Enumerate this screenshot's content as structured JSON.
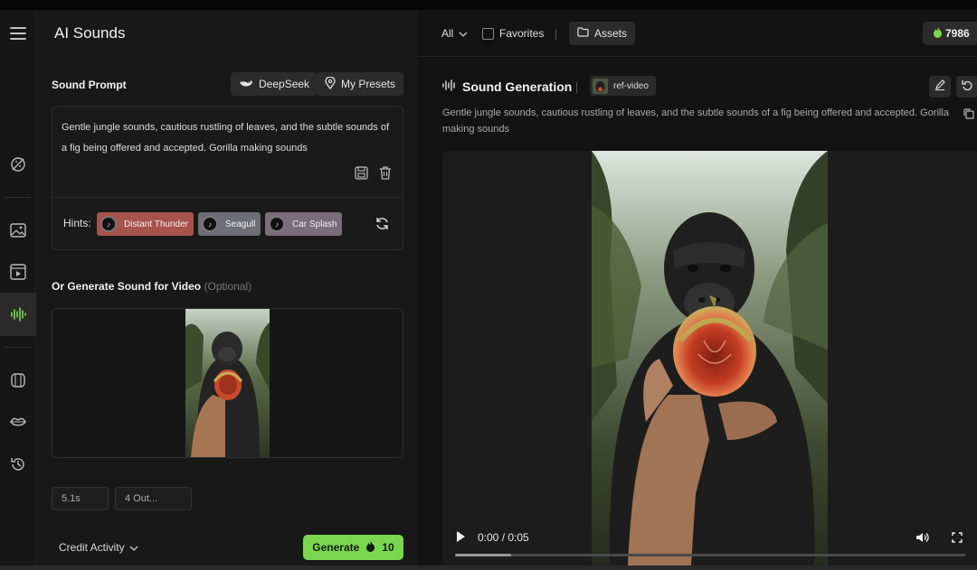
{
  "app": {
    "title": "AI Sounds"
  },
  "sound_prompt": {
    "title": "Sound Prompt",
    "deepseek_label": "DeepSeek",
    "presets_label": "My Presets",
    "text": "Gentle jungle sounds, cautious rustling of leaves, and the subtle sounds of a fig being offered and accepted. Gorilla making sounds",
    "hints_label": "Hints:",
    "hints": [
      {
        "label": "Distant Thunder",
        "color": "#a8524c"
      },
      {
        "label": "Seagull",
        "color": "#6e6e75"
      },
      {
        "label": "Car Splash",
        "color": "#7a6c78"
      }
    ]
  },
  "video_section": {
    "title": "Or Generate Sound for Video",
    "optional": "(Optional)"
  },
  "options": {
    "duration": "5.1s",
    "outputs": "4 Out..."
  },
  "footer": {
    "credit_activity": "Credit Activity",
    "generate_label": "Generate",
    "generate_cost": "10"
  },
  "filters": {
    "all": "All",
    "favorites": "Favorites",
    "assets": "Assets",
    "credits": "7986"
  },
  "generation": {
    "title": "Sound Generation",
    "ref_label": "ref-video",
    "description": "Gentle jungle sounds, cautious rustling of leaves, and the subtle sounds of a fig being offered and accepted. Gorilla making sounds",
    "time": "0:00 / 0:05",
    "progress": 0.11
  },
  "colors": {
    "accent_green": "#7bd74f",
    "panel": "#181818",
    "background": "#121212"
  },
  "icons": {
    "rail": [
      "menu-icon",
      "palette-off-icon",
      "image-icon",
      "video-icon",
      "audio-wave-icon",
      "cube-icon",
      "lips-icon",
      "history-icon"
    ]
  }
}
